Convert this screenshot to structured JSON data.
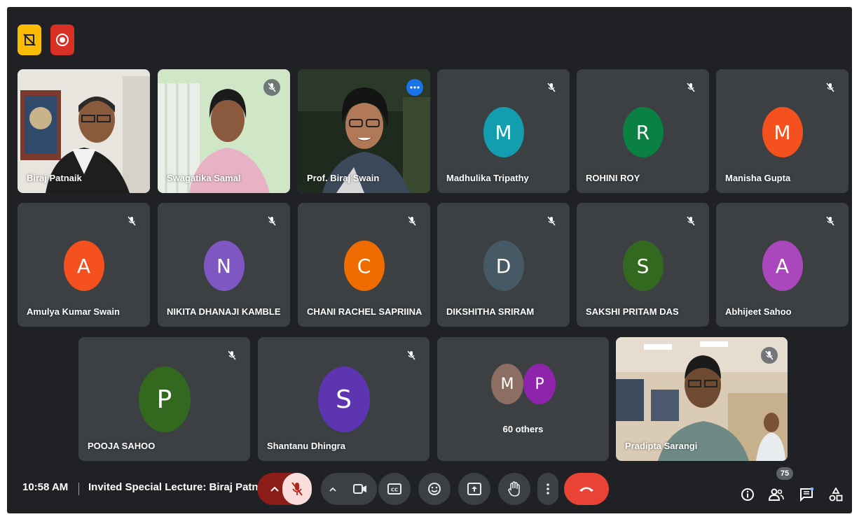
{
  "top_indicators": {
    "presentation_icon": "no-presentation-icon",
    "recording_icon": "recording-icon",
    "colors": {
      "presentation": "#fbbc04",
      "recording": "#d93025"
    }
  },
  "participants": {
    "video": [
      {
        "name": "Biraj Patnaik",
        "muted": false
      },
      {
        "name": "Swagatika Samal",
        "muted": true
      },
      {
        "name": "Prof. Biraj Swain",
        "muted": false,
        "active": true
      },
      {
        "name": "Pradipta Sarangi",
        "muted": true
      }
    ],
    "avatars": [
      {
        "name": "Madhulika Tripathy",
        "initial": "M",
        "color": "#129eaf"
      },
      {
        "name": "ROHINI ROY",
        "initial": "R",
        "color": "#0b8043"
      },
      {
        "name": "Manisha Gupta",
        "initial": "M",
        "color": "#f4511e"
      },
      {
        "name": "Amulya Kumar Swain",
        "initial": "A",
        "color": "#f4511e"
      },
      {
        "name": "NIKITA DHANAJI KAMBLE",
        "initial": "N",
        "color": "#7e57c2"
      },
      {
        "name": "CHANI RACHEL SAPRIINA",
        "initial": "C",
        "color": "#ef6c00"
      },
      {
        "name": "DIKSHITHA SRIRAM",
        "initial": "D",
        "color": "#455a64"
      },
      {
        "name": "SAKSHI PRITAM DAS",
        "initial": "S",
        "color": "#33691e"
      },
      {
        "name": "Abhijeet Sahoo",
        "initial": "A",
        "color": "#ab47bc"
      },
      {
        "name": "POOJA SAHOO",
        "initial": "P",
        "color": "#33691e"
      },
      {
        "name": "Shantanu Dhingra",
        "initial": "S",
        "color": "#5e35b1"
      }
    ],
    "others": {
      "label": "60 others",
      "initials": [
        "M",
        "P"
      ],
      "colors": [
        "#8d6e63",
        "#8e24aa"
      ]
    }
  },
  "bottom_bar": {
    "time": "10:58 AM",
    "separator": "|",
    "meeting_title": "Invited Special Lecture: Biraj Patn...",
    "controls": [
      "chevron-up-icon",
      "mic-off-icon",
      "chevron-up-icon",
      "camera-icon",
      "captions-icon",
      "emoji-icon",
      "present-icon",
      "raise-hand-icon",
      "more-options-icon",
      "end-call-icon"
    ],
    "right_icons": [
      "info-icon",
      "people-icon",
      "chat-icon",
      "activities-icon"
    ],
    "people_count": "75",
    "colors": {
      "end_call": "#ea4335",
      "mic_active_bg": "#f9dedc",
      "mic_chevron_bg": "#8c1d18",
      "control_bg": "#3c4043"
    }
  }
}
